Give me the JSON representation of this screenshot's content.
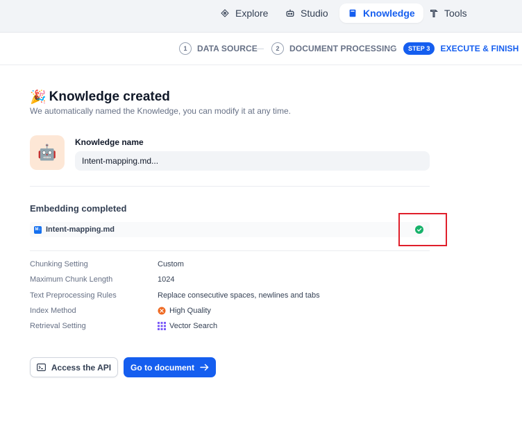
{
  "nav": {
    "items": [
      {
        "label": "Explore",
        "icon": "compass-icon"
      },
      {
        "label": "Studio",
        "icon": "robot-icon"
      },
      {
        "label": "Knowledge",
        "icon": "book-icon",
        "active": true
      },
      {
        "label": "Tools",
        "icon": "hammer-icon"
      }
    ]
  },
  "steps": [
    {
      "num": "1",
      "label": "DATA SOURCE"
    },
    {
      "num": "2",
      "label": "DOCUMENT PROCESSING"
    },
    {
      "num": "STEP 3",
      "label": "EXECUTE & FINISH",
      "current": true
    }
  ],
  "main": {
    "emoji": "🎉",
    "title": "Knowledge created",
    "subtitle": "We automatically named the Knowledge, you can modify it at any time.",
    "avatar_emoji": "🤖",
    "knowledge_name_label": "Knowledge name",
    "knowledge_name_value": "Intent-mapping.md..."
  },
  "embedding": {
    "title": "Embedding completed",
    "file_badge": "M↓",
    "file_name": "Intent-mapping.md",
    "status": "completed"
  },
  "settings": [
    {
      "label": "Chunking Setting",
      "value": "Custom"
    },
    {
      "label": "Maximum Chunk Length",
      "value": "1024"
    },
    {
      "label": "Text Preprocessing Rules",
      "value": "Replace consecutive spaces, newlines and tabs"
    },
    {
      "label": "Index Method",
      "value": "High Quality",
      "icon": "high-quality-icon"
    },
    {
      "label": "Retrieval Setting",
      "value": "Vector Search",
      "icon": "vector-search-icon"
    }
  ],
  "buttons": {
    "api": "Access the API",
    "document": "Go to document"
  },
  "colors": {
    "accent": "#155eef",
    "success": "#17b26a",
    "highlight": "#e01e2a"
  }
}
